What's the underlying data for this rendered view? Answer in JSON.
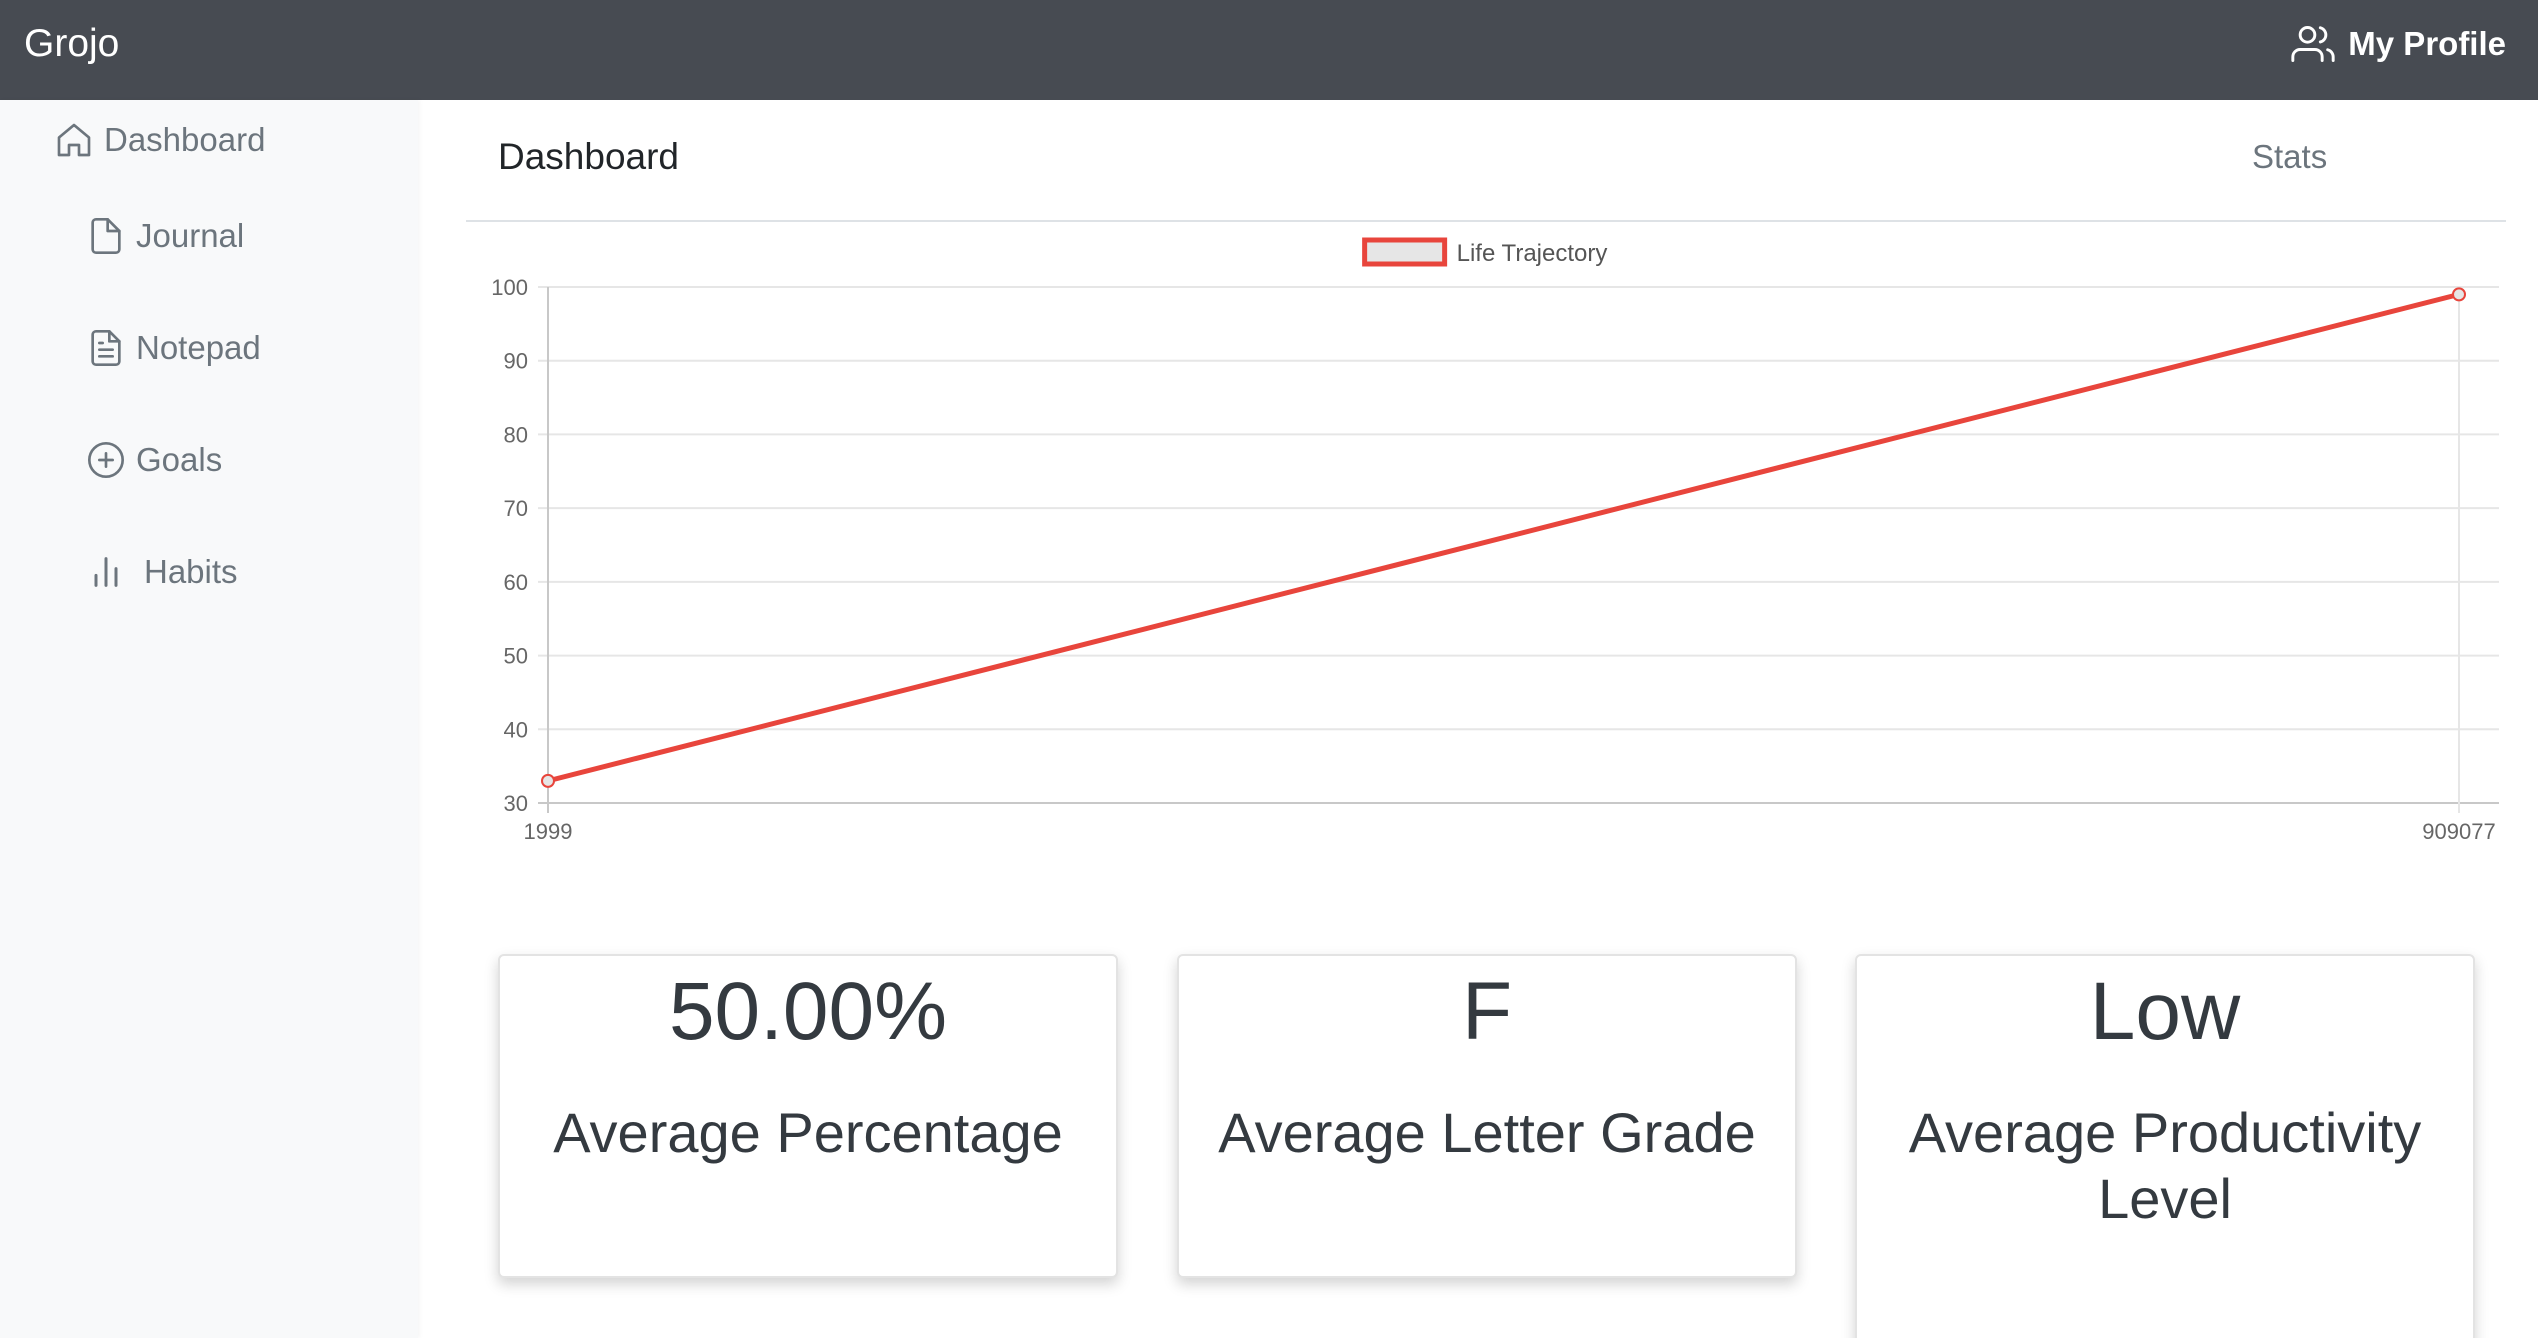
{
  "navbar": {
    "brand": "Grojo",
    "profile_label": "My Profile",
    "profile_icon": "users-icon",
    "background": "#474b52"
  },
  "sidebar": {
    "items": [
      {
        "label": "Dashboard",
        "icon": "home-icon"
      },
      {
        "label": "Journal",
        "icon": "file-icon"
      },
      {
        "label": "Notepad",
        "icon": "file-text-icon"
      },
      {
        "label": "Goals",
        "icon": "plus-circle-icon"
      },
      {
        "label": "Habits",
        "icon": "bar-chart-icon"
      }
    ]
  },
  "tabs": {
    "active": "Dashboard",
    "stats": "Stats"
  },
  "chart_data": {
    "type": "line",
    "x": [
      1999,
      909077
    ],
    "series": [
      {
        "name": "Life Trajectory",
        "values": [
          33,
          99
        ],
        "color": "#e8453c",
        "fill": "#e6e6e6"
      }
    ],
    "ylim": [
      30,
      100
    ],
    "yticks": [
      30,
      40,
      50,
      60,
      70,
      80,
      90,
      100
    ],
    "xticks": [
      "1999",
      "909077"
    ],
    "legend": "top-center",
    "grid": true
  },
  "cards": [
    {
      "value": "50.00%",
      "label": "Average Percentage"
    },
    {
      "value": "F",
      "label": "Average Letter Grade"
    },
    {
      "value": "Low",
      "label": "Average Productivity Level"
    }
  ]
}
